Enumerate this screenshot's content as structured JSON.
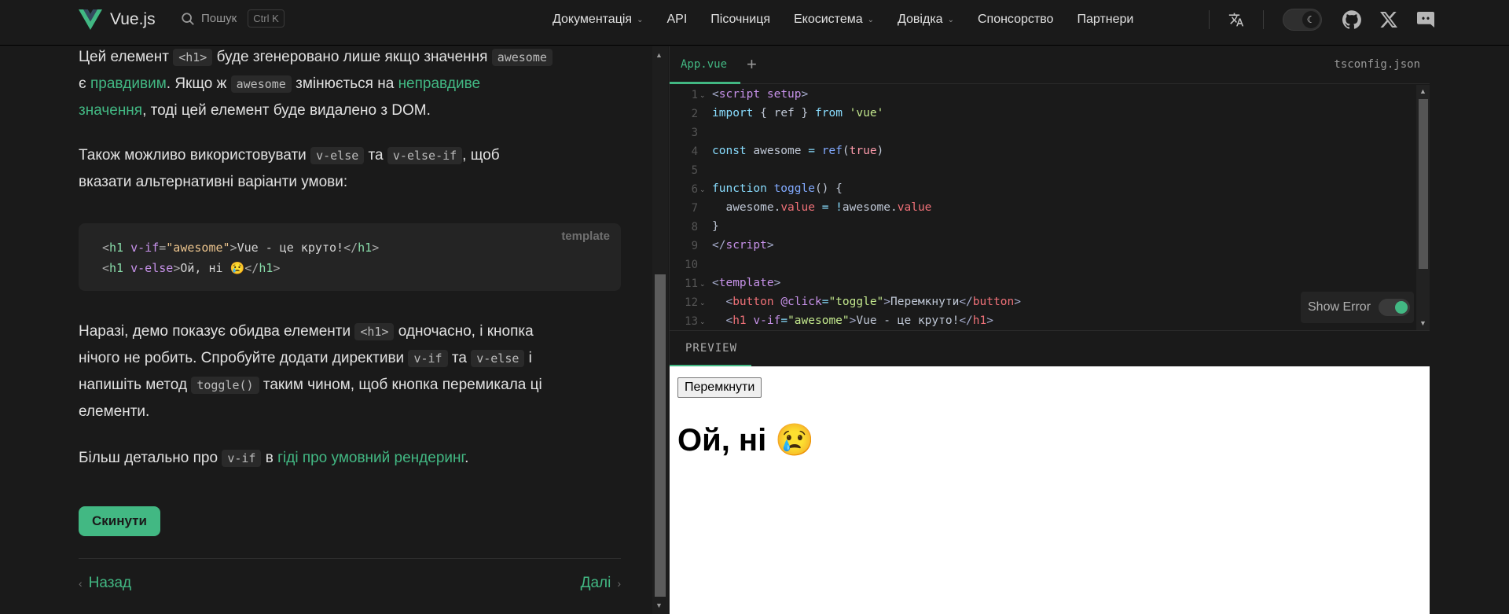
{
  "nav": {
    "logo_text": "Vue.js",
    "search_label": "Пошук",
    "search_kbd": "Ctrl K",
    "items": [
      {
        "label": "Документація",
        "dropdown": true
      },
      {
        "label": "API",
        "dropdown": false
      },
      {
        "label": "Пісочниця",
        "dropdown": false
      },
      {
        "label": "Екосистема",
        "dropdown": true
      },
      {
        "label": "Довідка",
        "dropdown": true
      },
      {
        "label": "Спонсорство",
        "dropdown": false
      },
      {
        "label": "Партнери",
        "dropdown": false
      }
    ]
  },
  "doc": {
    "p1": {
      "t1": "Цей елемент ",
      "c1": "<h1>",
      "t2": " буде згенеровано лише якщо значення ",
      "c2": "awesome",
      "t3": "є ",
      "link1": "правдивим",
      "t4": ". Якщо ж ",
      "c3": "awesome",
      "t5": " змінюється на ",
      "link2a": "неправдиве",
      "link2b": "значення",
      "t6": ", тоді цей елемент буде видалено з DOM."
    },
    "p2": {
      "t1": "Також можливо використовувати ",
      "c1": "v-else",
      "t2": " та ",
      "c2": "v-else-if",
      "t3": ", щоб",
      "t4": "вказати альтернативні варіанти умови:"
    },
    "codeblock": {
      "lang": "template",
      "line1": {
        "open": "<",
        "tag": "h1",
        "attr": " v-if",
        "eq": "=",
        "str": "\"awesome\"",
        "close": ">",
        "text": "Vue - це круто!",
        "end_open": "</",
        "end_tag": "h1",
        "end_close": ">"
      },
      "line2": {
        "open": "<",
        "tag": "h1",
        "attr": " v-else",
        "close": ">",
        "text": "Ой, ні 😢",
        "end_open": "</",
        "end_tag": "h1",
        "end_close": ">"
      }
    },
    "p3": {
      "t1": "Наразі, демо показує обидва елементи ",
      "c1": "<h1>",
      "t2": " одночасно, і кнопка",
      "t3": "нічого не робить. Спробуйте додати директиви ",
      "c2": "v-if",
      "t4": " та ",
      "c3": "v-else",
      "t5": " і",
      "t6": "напишіть метод ",
      "c4": "toggle()",
      "t7": " таким чином, щоб кнопка перемикала ці",
      "t8": "елементи."
    },
    "p4": {
      "t1": "Більш детально про ",
      "c1": "v-if",
      "t2": " в ",
      "link": "гіді про умовний рендеринг",
      "t3": "."
    },
    "reset_label": "Скинути",
    "prev_label": "Назад",
    "next_label": "Далі"
  },
  "repl": {
    "tab_active": "App.vue",
    "tab_add": "+",
    "tab_right": "tsconfig.json",
    "line_numbers": [
      "1",
      "2",
      "3",
      "4",
      "5",
      "6",
      "7",
      "8",
      "9",
      "10",
      "11",
      "12",
      "13"
    ],
    "code": {
      "l1a": "<",
      "l1b": "script",
      "l1c": " setup",
      "l1d": ">",
      "l2a": "import",
      "l2b": " { ",
      "l2c": "ref",
      "l2d": " } ",
      "l2e": "from",
      "l2f": " 'vue'",
      "l4a": "const",
      "l4b": " awesome ",
      "l4c": "=",
      "l4d": " ref",
      "l4e": "(",
      "l4f": "true",
      "l4g": ")",
      "l6a": "function",
      "l6b": " toggle",
      "l6c": "() {",
      "l7a": "  awesome",
      "l7b": ".",
      "l7c": "value",
      "l7d": " = ",
      "l7e": "!",
      "l7f": "awesome",
      "l7g": ".",
      "l7h": "value",
      "l8": "}",
      "l9a": "</",
      "l9b": "script",
      "l9c": ">",
      "l11a": "<",
      "l11b": "template",
      "l11c": ">",
      "l12a": "  <",
      "l12b": "button",
      "l12c": " @click",
      "l12d": "=",
      "l12e": "\"toggle\"",
      "l12f": ">",
      "l12g": "Перемкнути",
      "l12h": "</",
      "l12i": "button",
      "l12j": ">",
      "l13a": "  <",
      "l13b": "h1",
      "l13c": " v-if",
      "l13d": "=",
      "l13e": "\"awesome\"",
      "l13f": ">",
      "l13g": "Vue - це круто!",
      "l13h": "</",
      "l13i": "h1",
      "l13j": ">"
    },
    "show_error_label": "Show Error",
    "show_error_on": true,
    "preview_tab": "PREVIEW",
    "preview_button": "Перемкнути",
    "preview_heading": "Ой, ні 😢"
  },
  "colors": {
    "accent": "#42b883",
    "background": "#1a1a1a"
  }
}
